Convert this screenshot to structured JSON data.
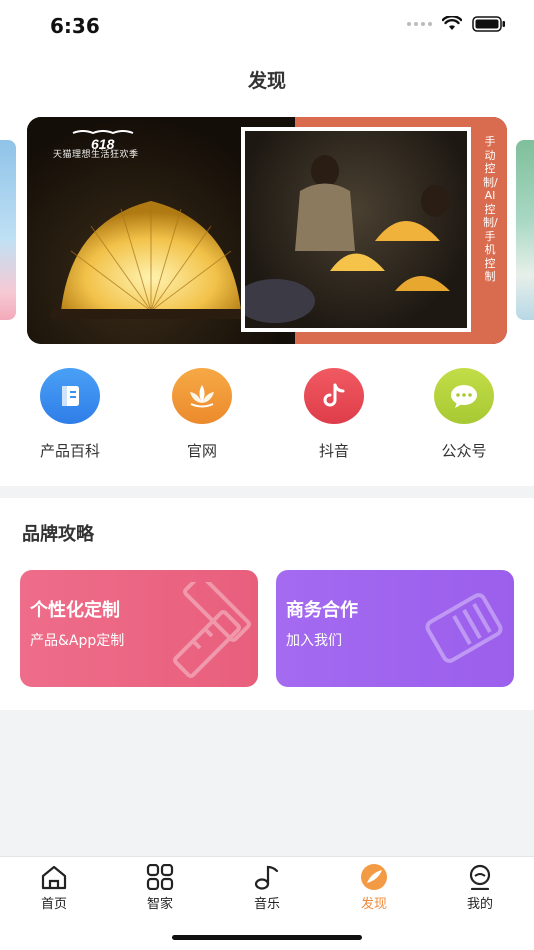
{
  "status": {
    "time": "6:36"
  },
  "nav": {
    "title": "发现"
  },
  "banner": {
    "logo_text": "618",
    "logo_sub": "天猫理想生活狂欢季",
    "vertical_text": "手动控制/AI控制/手机控制"
  },
  "quick_links": [
    {
      "label": "产品百科",
      "icon": "book-icon",
      "color": "#3d8ff0"
    },
    {
      "label": "官网",
      "icon": "lotus-icon",
      "color": "#f09a3a"
    },
    {
      "label": "抖音",
      "icon": "tiktok-icon",
      "color": "#e84a55"
    },
    {
      "label": "公众号",
      "icon": "wechat-icon",
      "color": "#b5d43a"
    }
  ],
  "brand": {
    "title": "品牌攻略",
    "cards": [
      {
        "title": "个性化定制",
        "subtitle": "产品&App定制",
        "color": "#ec6685"
      },
      {
        "title": "商务合作",
        "subtitle": "加入我们",
        "color": "#a066ee"
      }
    ]
  },
  "tabs": [
    {
      "label": "首页",
      "icon": "home-icon",
      "active": false
    },
    {
      "label": "智家",
      "icon": "grid-icon",
      "active": false
    },
    {
      "label": "音乐",
      "icon": "music-note-icon",
      "active": false
    },
    {
      "label": "发现",
      "icon": "discover-icon",
      "active": true
    },
    {
      "label": "我的",
      "icon": "profile-icon",
      "active": false
    }
  ],
  "colors": {
    "accent": "#f08b3a",
    "banner_right": "#d96b4e"
  }
}
